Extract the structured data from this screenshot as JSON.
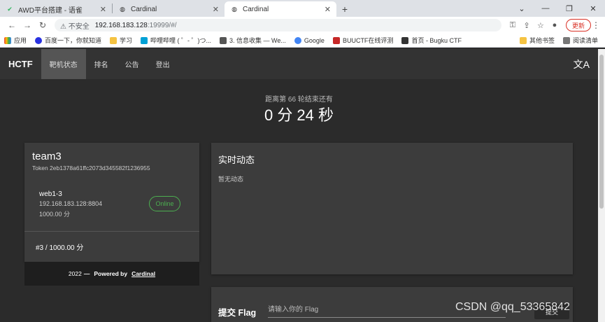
{
  "browser": {
    "tabs": [
      {
        "title": "AWD平台搭建 - 语雀",
        "active": false
      },
      {
        "title": "Cardinal",
        "active": false
      },
      {
        "title": "Cardinal",
        "active": true
      }
    ],
    "insecure_label": "不安全",
    "url_host": "192.168.183.128",
    "url_path": ":19999/#/",
    "update_label": "更新",
    "bookmarks": [
      {
        "label": "应用"
      },
      {
        "label": "百度一下，你就知道"
      },
      {
        "label": "学习"
      },
      {
        "label": "哔哩哔哩 ( ゜- ゜)つ..."
      },
      {
        "label": "3. 信息收集 — We..."
      },
      {
        "label": "Google"
      },
      {
        "label": "BUUCTF在线评测"
      },
      {
        "label": "首页 - Bugku CTF"
      }
    ],
    "other_bookmarks": "其他书签",
    "reading_list": "阅读清单"
  },
  "nav": {
    "brand": "HCTF",
    "items": [
      {
        "label": "靶机状态",
        "active": true
      },
      {
        "label": "排名",
        "active": false
      },
      {
        "label": "公告",
        "active": false
      },
      {
        "label": "登出",
        "active": false
      }
    ]
  },
  "countdown": {
    "label": "距离第 66 轮结束还有",
    "time": "0 分 24 秒"
  },
  "team": {
    "name": "team3",
    "token": "Token 2eb1378a61ffc2073d345582f1236955",
    "gamebox": {
      "name": "web1-3",
      "address": "192.168.183.128:8804",
      "score": "1000.00 分",
      "status": "Online"
    },
    "rank": "#3 / 1000.00 分"
  },
  "footer": {
    "year": "2022",
    "dash": "—",
    "powered": "Powered by",
    "link": "Cardinal"
  },
  "feed": {
    "title": "实时动态",
    "empty": "暂无动态"
  },
  "flag": {
    "label": "提交 Flag",
    "placeholder": "请输入你的 Flag",
    "submit": "提交"
  },
  "watermark": "CSDN @qq_53365842",
  "colors": {
    "online": "#4caf50",
    "nav_bg": "#333333",
    "page_bg": "#2b2b2b",
    "card_bg": "#3c3c3c"
  }
}
